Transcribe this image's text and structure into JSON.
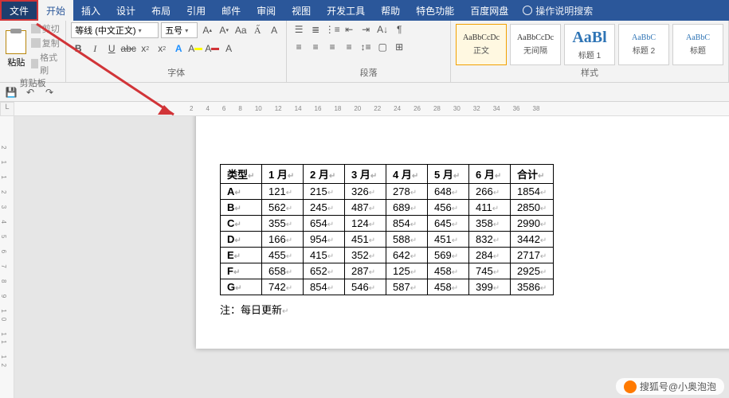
{
  "menu": {
    "file": "文件",
    "home": "开始",
    "insert": "插入",
    "design": "设计",
    "layout": "布局",
    "references": "引用",
    "mail": "邮件",
    "review": "审阅",
    "view": "视图",
    "dev": "开发工具",
    "help": "帮助",
    "special": "特色功能",
    "baidu": "百度网盘",
    "tell_me": "操作说明搜索"
  },
  "ribbon": {
    "clipboard": {
      "label": "剪贴板",
      "paste": "粘贴",
      "cut": "剪切",
      "copy": "复制",
      "format_painter": "格式刷"
    },
    "font": {
      "label": "字体",
      "family": "等线 (中文正文)",
      "size": "五号"
    },
    "paragraph": {
      "label": "段落"
    },
    "styles": {
      "label": "样式",
      "preview": "AaBbCcDc",
      "preview_big": "AaBl",
      "preview_h": "AaBbC",
      "items": [
        "正文",
        "无间隔",
        "标题 1",
        "标题 2",
        "标题"
      ]
    }
  },
  "doc": {
    "headers": [
      "类型",
      "1 月",
      "2 月",
      "3 月",
      "4 月",
      "5 月",
      "6 月",
      "合计"
    ],
    "rows": [
      [
        "A",
        "121",
        "215",
        "326",
        "278",
        "648",
        "266",
        "1854"
      ],
      [
        "B",
        "562",
        "245",
        "487",
        "689",
        "456",
        "411",
        "2850"
      ],
      [
        "C",
        "355",
        "654",
        "124",
        "854",
        "645",
        "358",
        "2990"
      ],
      [
        "D",
        "166",
        "954",
        "451",
        "588",
        "451",
        "832",
        "3442"
      ],
      [
        "E",
        "455",
        "415",
        "352",
        "642",
        "569",
        "284",
        "2717"
      ],
      [
        "F",
        "658",
        "652",
        "287",
        "125",
        "458",
        "745",
        "2925"
      ],
      [
        "G",
        "742",
        "854",
        "546",
        "587",
        "458",
        "399",
        "3586"
      ]
    ],
    "note": "注：每日更新"
  },
  "watermark": "搜狐号@小奥泡泡",
  "ruler_h": [
    "2",
    "4",
    "6",
    "8",
    "10",
    "12",
    "14",
    "16",
    "18",
    "20",
    "22",
    "24",
    "26",
    "28",
    "30",
    "32",
    "34",
    "36",
    "38"
  ],
  "ruler_v": [
    "2",
    "1",
    "1",
    "2",
    "3",
    "4",
    "5",
    "6",
    "7",
    "8",
    "9",
    "10",
    "11",
    "12"
  ]
}
